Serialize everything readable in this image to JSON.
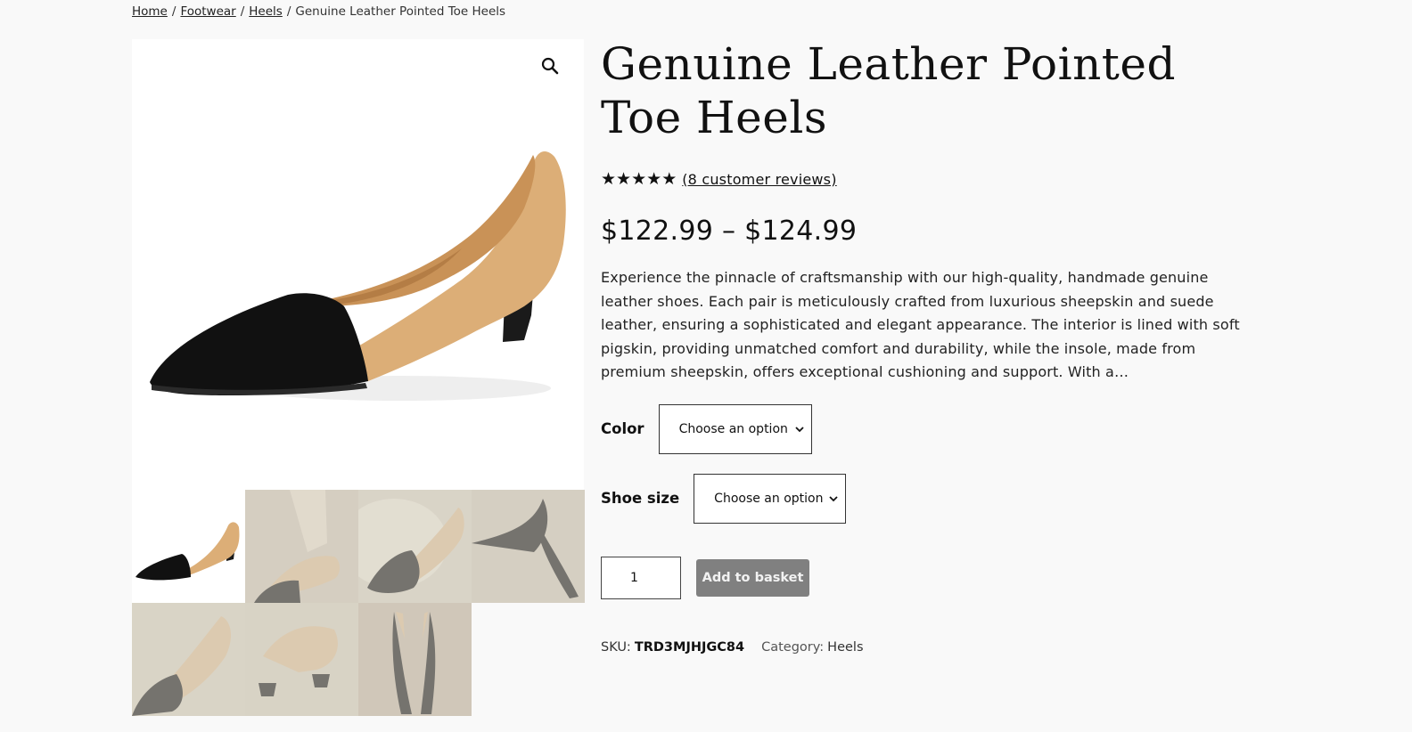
{
  "breadcrumb": {
    "home": "Home",
    "footwear": "Footwear",
    "heels": "Heels",
    "current": "Genuine Leather Pointed Toe Heels",
    "separator": "/"
  },
  "product": {
    "title": "Genuine Leather Pointed Toe Heels",
    "rating": 5,
    "review_link": "(8 customer reviews)",
    "price": "$122.99 – $124.99",
    "description": "Experience the pinnacle of craftsmanship with our high-quality, handmade genuine leather shoes. Each pair is meticulously crafted from luxurious sheepskin and suede leather, ensuring a sophisticated and elegant appearance. The interior is lined with soft pigskin, providing unmatched comfort and durability, while the insole, made from premium sheepskin, offers exceptional cushioning and support. With a…"
  },
  "variations": {
    "color_label": "Color",
    "color_value": "Choose an option",
    "size_label": "Shoe size",
    "size_value": "Choose an option"
  },
  "cart": {
    "quantity": "1",
    "add_label": "Add to basket"
  },
  "meta": {
    "sku_label": "SKU:",
    "sku_value": "TRD3MJHJGC84",
    "category_label": "Category:",
    "category_value": "Heels"
  },
  "icons": {
    "zoom": "magnifier-icon",
    "select": "chevron-down-icon",
    "star": "star-icon"
  },
  "colors": {
    "background": "#f9f9f9",
    "button": "#808080",
    "shoe_tan": "#d9ad78",
    "shoe_black": "#111111"
  }
}
